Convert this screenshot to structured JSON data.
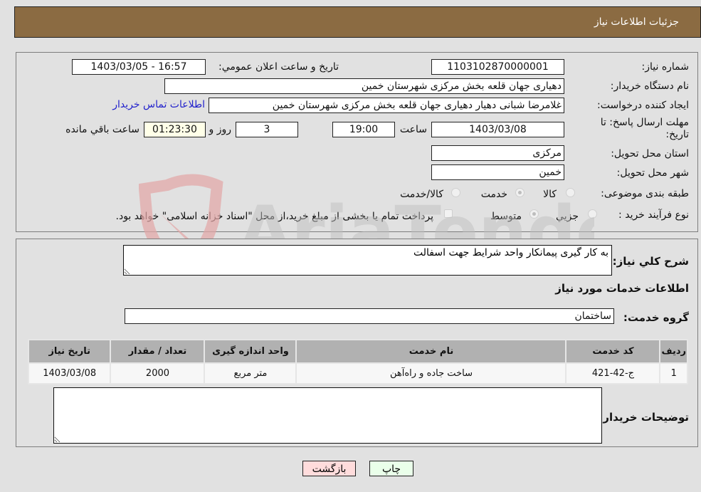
{
  "header": {
    "title": "جزئیات اطلاعات نیاز"
  },
  "form": {
    "need_number": {
      "label": "شماره نیاز:",
      "value": "1103102870000001"
    },
    "announce_datetime": {
      "label": "تاریخ و ساعت اعلان عمومي:",
      "value": "1403/03/05 - 16:57"
    },
    "buyer_org": {
      "label": "نام دستگاه خريدار:",
      "value": "دهیاری جهان قلعه بخش مرکزی شهرستان خمین"
    },
    "requester": {
      "label": "ایجاد کننده درخواست:",
      "value": "غلامرضا شبانی دهیار دهیاری جهان قلعه بخش مرکزی شهرستان خمین"
    },
    "buyer_contact_link": "اطلاعات تماس خریدار",
    "deadline": {
      "label": "مهلت ارسال پاسخ: تا تاریخ:",
      "date": "1403/03/08",
      "time_label": "ساعت",
      "time": "19:00",
      "days": "3",
      "days_label": "روز و",
      "remaining": "01:23:30",
      "remaining_label": "ساعت باقي مانده"
    },
    "province": {
      "label": "استان محل تحویل:",
      "value": "مرکزی"
    },
    "city": {
      "label": "شهر محل تحویل:",
      "value": "خمین"
    },
    "category": {
      "label": "طبقه بندی موضوعی:",
      "options": [
        "کالا",
        "خدمت",
        "کالا/خدمت"
      ],
      "selected": "خدمت"
    },
    "purchase_type": {
      "label": "نوع فرآيند خريد :",
      "options": [
        "جزيي",
        "متوسط"
      ],
      "selected": "متوسط",
      "treasury_checkbox_label": "پرداخت تمام یا بخشی از مبلغ خرید،از محل \"اسناد خزانه اسلامی\" خواهد بود.",
      "treasury_checked": false
    }
  },
  "details": {
    "description": {
      "label": "شرح کلي نياز:",
      "value": "به کار گیری پیمانکار واحد شرایط جهت اسفالت"
    },
    "services_heading": "اطلاعات خدمات مورد نياز",
    "service_group": {
      "label": "گروه خدمت:",
      "value": "ساختمان"
    },
    "table": {
      "columns": [
        "رديف",
        "کد خدمت",
        "نام خدمت",
        "واحد اندازه گيری",
        "تعداد / مقدار",
        "تاريخ نياز"
      ],
      "rows": [
        [
          "1",
          "ج-42-421",
          "ساخت جاده و راه‌آهن",
          "متر مربع",
          "2000",
          "1403/03/08"
        ]
      ]
    },
    "buyer_notes": {
      "label": "توضیحات خریدار:",
      "value": ""
    }
  },
  "buttons": {
    "print": "چاپ",
    "back": "بازگشت"
  },
  "watermark": {
    "text": "AriaTender.neT"
  },
  "colors": {
    "header": "#8b6b42",
    "print_btn": "#eaffea",
    "back_btn": "#ffdcdc",
    "link": "#2222cc"
  }
}
